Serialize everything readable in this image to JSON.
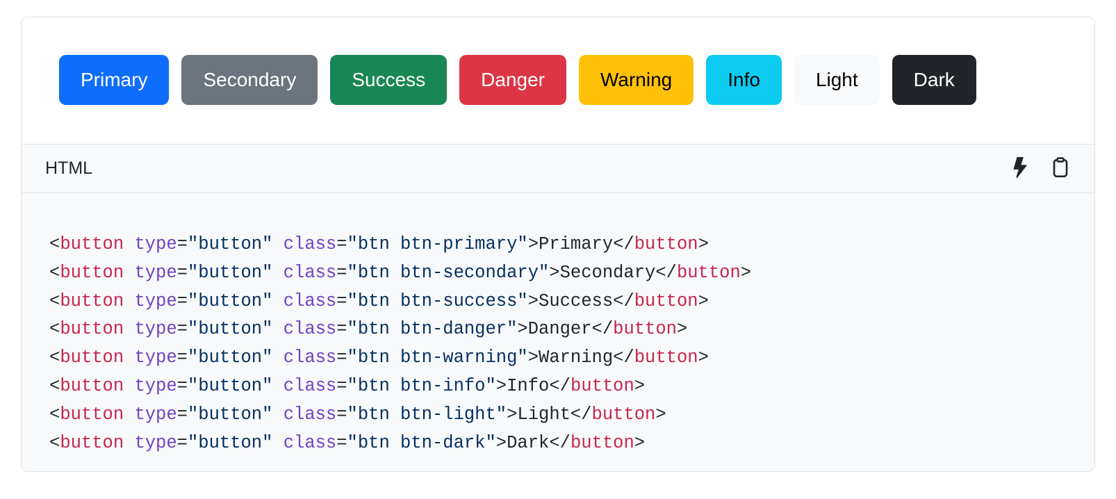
{
  "buttons": [
    {
      "key": "primary",
      "class": "btn-primary",
      "label": "Primary"
    },
    {
      "key": "secondary",
      "class": "btn-secondary",
      "label": "Secondary"
    },
    {
      "key": "success",
      "class": "btn-success",
      "label": "Success"
    },
    {
      "key": "danger",
      "class": "btn-danger",
      "label": "Danger"
    },
    {
      "key": "warning",
      "class": "btn-warning",
      "label": "Warning"
    },
    {
      "key": "info",
      "class": "btn-info",
      "label": "Info"
    },
    {
      "key": "light",
      "class": "btn-light",
      "label": "Light"
    },
    {
      "key": "dark",
      "class": "btn-dark",
      "label": "Dark"
    }
  ],
  "toolbar": {
    "language_label": "HTML"
  },
  "code_lines": [
    {
      "class": "btn btn-primary",
      "text": "Primary"
    },
    {
      "class": "btn btn-secondary",
      "text": "Secondary"
    },
    {
      "class": "btn btn-success",
      "text": "Success"
    },
    {
      "class": "btn btn-danger",
      "text": "Danger"
    },
    {
      "class": "btn btn-warning",
      "text": "Warning"
    },
    {
      "class": "btn btn-info",
      "text": "Info"
    },
    {
      "class": "btn btn-light",
      "text": "Light"
    },
    {
      "class": "btn btn-dark",
      "text": "Dark"
    }
  ]
}
